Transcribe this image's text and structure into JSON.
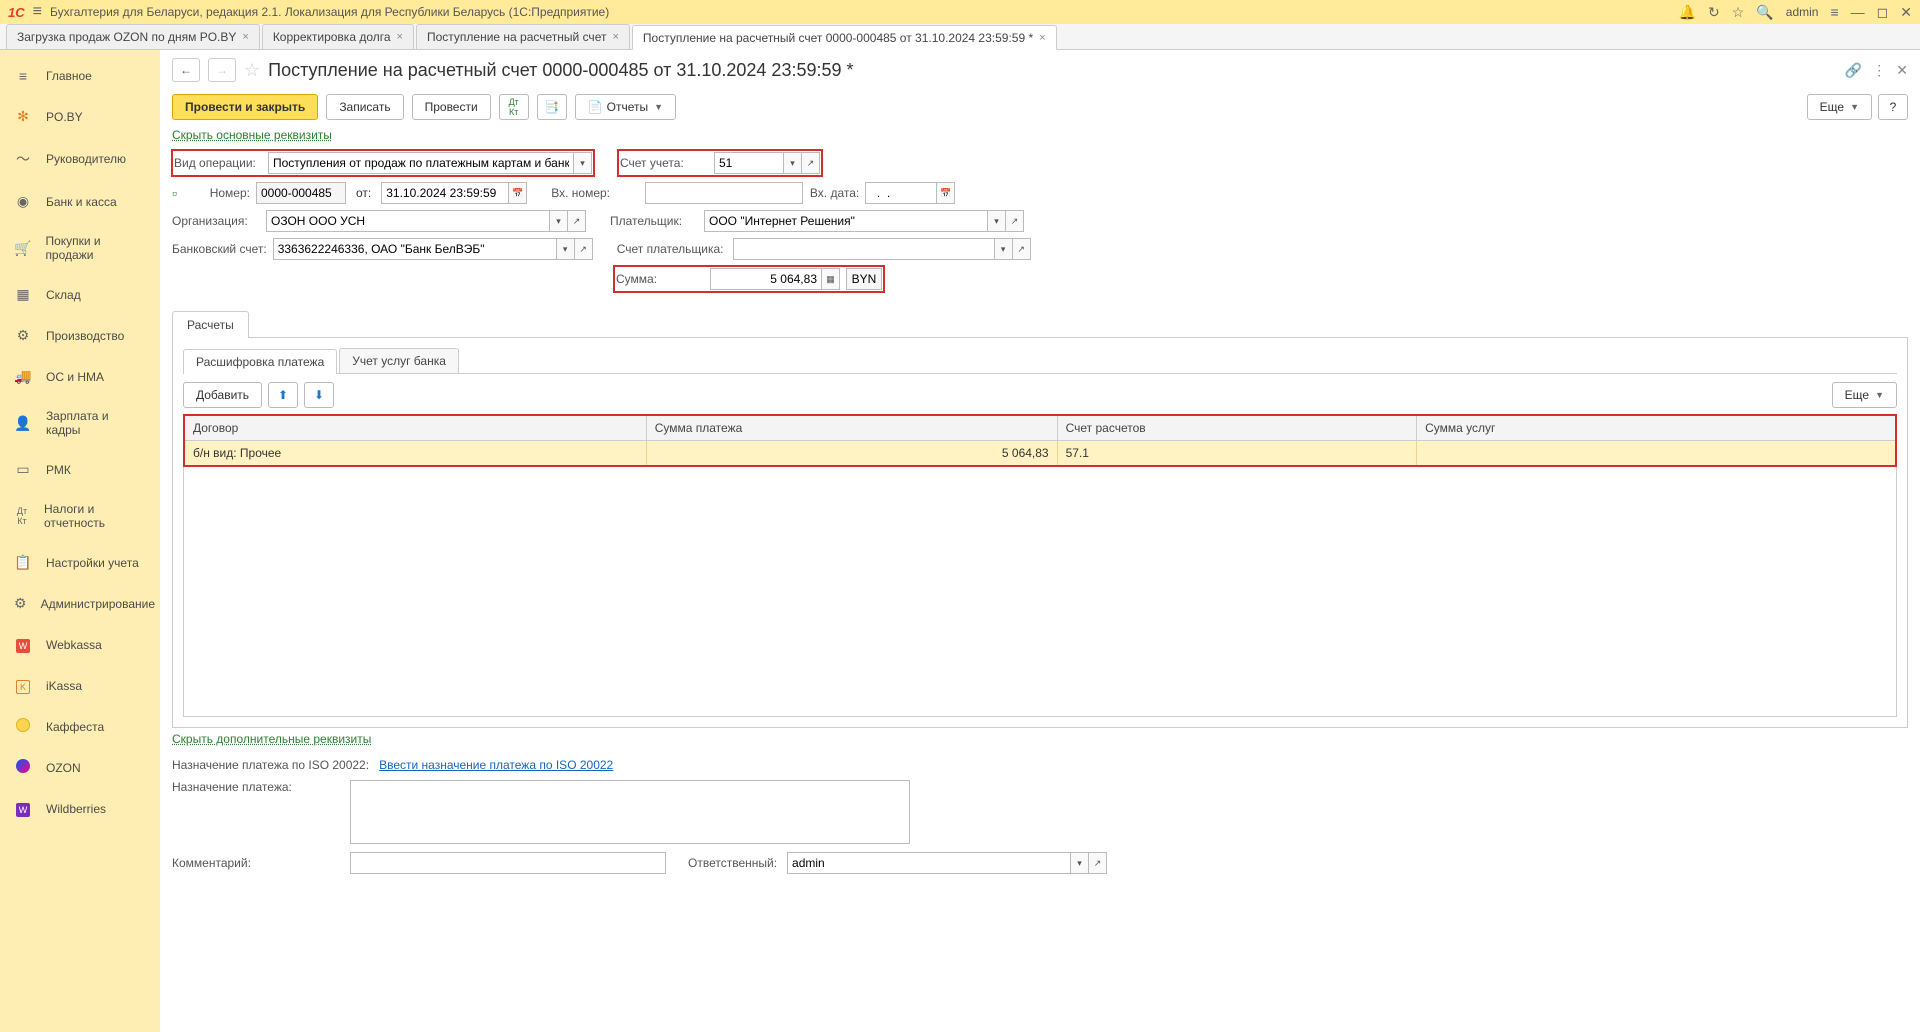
{
  "titlebar": {
    "logo": "1C",
    "title": "Бухгалтерия для Беларуси, редакция 2.1. Локализация для Республики Беларусь   (1С:Предприятие)",
    "user": "admin"
  },
  "tabs": [
    {
      "label": "Загрузка продаж OZON по дням PO.BY"
    },
    {
      "label": "Корректировка долга"
    },
    {
      "label": "Поступление на расчетный счет"
    },
    {
      "label": "Поступление на расчетный счет 0000-000485 от 31.10.2024 23:59:59 *",
      "active": true
    }
  ],
  "sidebar": {
    "items": [
      {
        "label": "Главное",
        "icon": "≡"
      },
      {
        "label": "PO.BY",
        "icon": "✻"
      },
      {
        "label": "Руководителю",
        "icon": "〜"
      },
      {
        "label": "Банк и касса",
        "icon": "◉"
      },
      {
        "label": "Покупки и продажи",
        "icon": "🛒"
      },
      {
        "label": "Склад",
        "icon": "▦"
      },
      {
        "label": "Производство",
        "icon": "⚙"
      },
      {
        "label": "ОС и НМА",
        "icon": "🚚"
      },
      {
        "label": "Зарплата и кадры",
        "icon": "👤"
      },
      {
        "label": "РМК",
        "icon": "▭"
      },
      {
        "label": "Налоги и отчетность",
        "icon": "Дт"
      },
      {
        "label": "Настройки учета",
        "icon": "📋"
      },
      {
        "label": "Администрирование",
        "icon": "⚙"
      },
      {
        "label": "Webkassa",
        "icon": "w"
      },
      {
        "label": "iKassa",
        "icon": "K"
      },
      {
        "label": "Каффеста",
        "icon": "●"
      },
      {
        "label": "OZON",
        "icon": "o"
      },
      {
        "label": "Wildberries",
        "icon": "W"
      }
    ]
  },
  "page": {
    "title": "Поступление на расчетный счет 0000-000485 от 31.10.2024 23:59:59 *"
  },
  "toolbar": {
    "post_close": "Провести и закрыть",
    "write": "Записать",
    "post": "Провести",
    "reports": "Отчеты",
    "more": "Еще",
    "help": "?"
  },
  "links": {
    "hide_main": "Скрыть основные реквизиты",
    "hide_add": "Скрыть дополнительные реквизиты",
    "enter_purpose": "Ввести назначение платежа по ISO 20022"
  },
  "form": {
    "operation_type_label": "Вид операции:",
    "operation_type_value": "Поступления от продаж по платежным картам и банковским кре",
    "account_label": "Счет учета:",
    "account_value": "51",
    "number_label": "Номер:",
    "number_value": "0000-000485",
    "from_label": "от:",
    "date_value": "31.10.2024 23:59:59",
    "ext_number_label": "Вх. номер:",
    "ext_number_value": "",
    "ext_date_label": "Вх. дата:",
    "ext_date_value": "  .  .",
    "org_label": "Организация:",
    "org_value": "ОЗОН ООО УСН",
    "payer_label": "Плательщик:",
    "payer_value": "ООО \"Интернет Решения\"",
    "bank_label": "Банковский счет:",
    "bank_value": "3363622246336, ОАО \"Банк БелВЭБ\"",
    "payer_account_label": "Счет плательщика:",
    "payer_account_value": "",
    "sum_label": "Сумма:",
    "sum_value": "5 064,83",
    "currency": "BYN"
  },
  "inner_tabs": {
    "calc": "Расчеты"
  },
  "sub_tabs": {
    "breakdown": "Расшифровка платежа",
    "bank_services": "Учет услуг банка"
  },
  "table_toolbar": {
    "add": "Добавить",
    "more": "Еще"
  },
  "pay_table": {
    "headers": [
      "Договор",
      "Сумма платежа",
      "Счет расчетов",
      "Сумма услуг"
    ],
    "rows": [
      {
        "contract": "б/н вид: Прочее",
        "amount": "5 064,83",
        "account": "57.1",
        "service_sum": ""
      }
    ]
  },
  "bottom": {
    "purpose_iso_label": "Назначение платежа по ISO 20022:",
    "purpose_label": "Назначение платежа:",
    "purpose_value": "",
    "comment_label": "Комментарий:",
    "comment_value": "",
    "responsible_label": "Ответственный:",
    "responsible_value": "admin"
  }
}
